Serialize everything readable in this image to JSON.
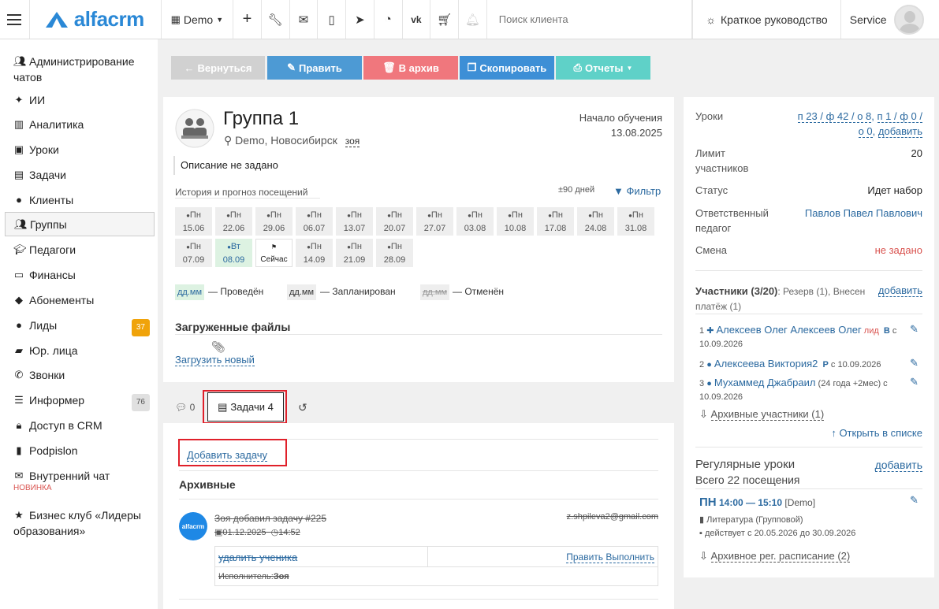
{
  "topbar": {
    "logo": "alfacrm",
    "branch": "Demo",
    "search_placeholder": "Поиск клиента",
    "guide": "Краткое руководство",
    "user": "Service"
  },
  "sidebar": {
    "items": [
      {
        "label": "Администрирование чатов",
        "icon": "users-icon"
      },
      {
        "label": "ИИ",
        "icon": "sparkle-icon"
      },
      {
        "label": "Аналитика",
        "icon": "map-icon"
      },
      {
        "label": "Уроки",
        "icon": "calendar-icon"
      },
      {
        "label": "Задачи",
        "icon": "clipboard-icon"
      },
      {
        "label": "Клиенты",
        "icon": "user-icon"
      },
      {
        "label": "Группы",
        "icon": "group-icon"
      },
      {
        "label": "Педагоги",
        "icon": "graduation-icon"
      },
      {
        "label": "Финансы",
        "icon": "money-icon"
      },
      {
        "label": "Абонементы",
        "icon": "tag-icon"
      },
      {
        "label": "Лиды",
        "icon": "user-plus-icon",
        "badge": "37"
      },
      {
        "label": "Юр. лица",
        "icon": "briefcase-icon"
      },
      {
        "label": "Звонки",
        "icon": "phone-icon"
      },
      {
        "label": "Информер",
        "icon": "list-icon",
        "badge": "76"
      },
      {
        "label": "Доступ в CRM",
        "icon": "lock-icon"
      },
      {
        "label": "Podpislon",
        "icon": "file-icon"
      },
      {
        "label": "Внутренний чат",
        "icon": "mail-icon",
        "sub": "НОВИНКА"
      },
      {
        "label": "Бизнес клуб «Лидеры образования»",
        "icon": "star-icon"
      }
    ]
  },
  "toolbar": {
    "back": "Вернуться",
    "edit": "Править",
    "archive": "В архив",
    "copy": "Скопировать",
    "reports": "Отчеты"
  },
  "group": {
    "title": "Группа 1",
    "location": "Demo, Новосибирск",
    "tag": "зоя",
    "start_label": "Начало обучения",
    "start_date": "13.08.2025",
    "description": "Описание не задано",
    "history_label": "История и прогноз посещений",
    "range": "±90 дней",
    "filter": "Фильтр",
    "days": [
      {
        "wd": "Пн",
        "date": "15.06"
      },
      {
        "wd": "Пн",
        "date": "22.06"
      },
      {
        "wd": "Пн",
        "date": "29.06"
      },
      {
        "wd": "Пн",
        "date": "06.07"
      },
      {
        "wd": "Пн",
        "date": "13.07"
      },
      {
        "wd": "Пн",
        "date": "20.07"
      },
      {
        "wd": "Пн",
        "date": "27.07"
      },
      {
        "wd": "Пн",
        "date": "03.08"
      },
      {
        "wd": "Пн",
        "date": "10.08"
      },
      {
        "wd": "Пн",
        "date": "17.08"
      },
      {
        "wd": "Пн",
        "date": "24.08"
      },
      {
        "wd": "Пн",
        "date": "31.08"
      },
      {
        "wd": "Пн",
        "date": "07.09"
      },
      {
        "wd": "Вт",
        "date": "08.09"
      },
      {
        "wd": "",
        "date": "Сейчас"
      },
      {
        "wd": "Пн",
        "date": "14.09"
      },
      {
        "wd": "Пн",
        "date": "21.09"
      },
      {
        "wd": "Пн",
        "date": "28.09"
      }
    ],
    "legend": [
      {
        "box": "дд.мм",
        "text": "— Проведён"
      },
      {
        "box": "дд.мм",
        "text": "— Запланирован"
      },
      {
        "box": "дд.мм",
        "text": "— Отменён"
      }
    ],
    "files_title": "Загруженные файлы",
    "upload": "Загрузить новый"
  },
  "tabs": {
    "chat_count": "0",
    "tasks": "Задачи 4"
  },
  "tasks": {
    "add": "Добавить задачу",
    "archived_title": "Архивные",
    "item": {
      "logo": "alfacrm",
      "author": "Зоя",
      "action": "добавил задачу #225",
      "email": "z.shpileva2@gmail.com",
      "date": "01.12.2025",
      "time": "14:52",
      "title": "удалить ученика",
      "edit": "Править",
      "done": "Выполнить",
      "executor_label": "Исполнитель:",
      "executor": "Зоя"
    }
  },
  "info": {
    "lessons_label": "Уроки",
    "lessons_val1": "п 23 / ф 42 / о 8",
    "lessons_val2": "п 1 / ф 0 /",
    "lessons_val3": "о 0",
    "lessons_add": "добавить",
    "limit_label": "Лимит участников",
    "limit_val": "20",
    "status_label": "Статус",
    "status_val": "Идет набор",
    "teacher_label": "Ответственный педагог",
    "teacher_val": "Павлов Павел Павлович",
    "shift_label": "Смена",
    "shift_val": "не задано",
    "members_head": "Участники (3/20)",
    "members_sub": ": Резерв (1), Внесен платёж (1)",
    "members_add": "добавить",
    "members": [
      {
        "n": "1",
        "name": "Алексеев Олег Алексеев Олег",
        "tag": "лид",
        "tag2": "В",
        "since": "с",
        "since2": "10.09.2026"
      },
      {
        "n": "2",
        "name": "Алексеева Виктория2",
        "tag": "Р",
        "since": "с 10.09.2026"
      },
      {
        "n": "3",
        "name": "Мухаммед Джабраил",
        "extra": "(24 года +2мес)",
        "since": "с",
        "since2": "10.09.2026"
      }
    ],
    "archived_members": "Архивные участники (1)",
    "open_list": "Открыть в списке",
    "regular_head": "Регулярные уроки",
    "regular_add": "добавить",
    "regular_total": "Всего 22 посещения",
    "regular_day": "ПН",
    "regular_time": "14:00 — 15:10",
    "regular_branch": "[Demo]",
    "regular_subject": "Литература (Групповой)",
    "regular_period": "действует с 20.05.2026 до 30.09.2026",
    "archived_schedule": "Архивное рег. расписание (2)"
  },
  "colors": {
    "back": "#d1d1d1",
    "edit": "#4d9ad4",
    "archive": "#f0777d",
    "copy": "#3d8fd6",
    "reports": "#5fd1c8",
    "highlight": "#e0202a"
  }
}
